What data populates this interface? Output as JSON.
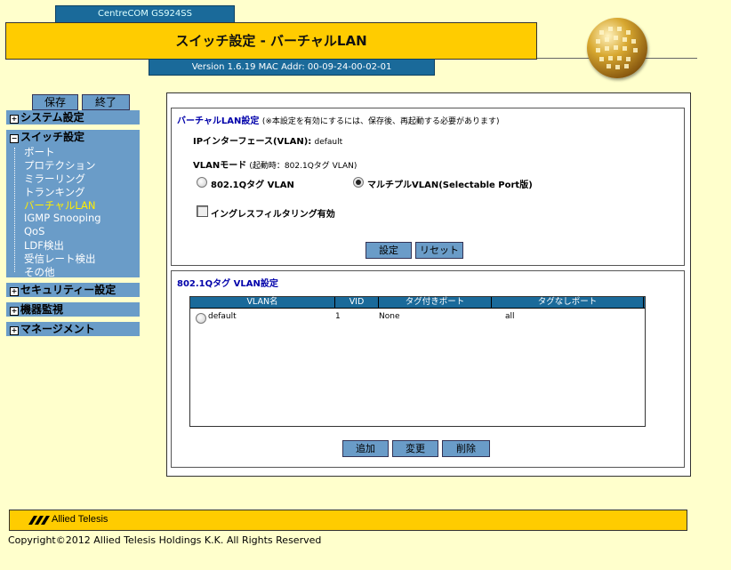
{
  "header": {
    "model": "CentreCOM GS924SS",
    "title": "スイッチ設定 - バーチャルLAN",
    "version": "Version 1.6.19 MAC Addr: 00-09-24-00-02-01"
  },
  "toolbar": {
    "save_label": "保存",
    "exit_label": "終了"
  },
  "sidebar": {
    "system": "システム設定",
    "switch": "スイッチ設定",
    "items": [
      "ポート",
      "プロテクション",
      "ミラーリング",
      "トランキング",
      "バーチャルLAN",
      "IGMP Snooping",
      "QoS",
      "LDF検出",
      "受信レート検出",
      "その他"
    ],
    "active_item": "バーチャルLAN",
    "security": "セキュリティー設定",
    "monitor": "機器監視",
    "management": "マネージメント",
    "expand_glyph": "+",
    "collapse_glyph": "−"
  },
  "vlan_settings": {
    "title": "バーチャルLAN設定",
    "note": "(※本設定を有効にするには、保存後、再起動する必要があります)",
    "ip_interface_label": "IPインターフェース(VLAN):",
    "ip_interface_value": "default",
    "mode_label": "VLANモード",
    "mode_note": "(起動時：802.1Qタグ VLAN)",
    "option_tag": "802.1Qタグ VLAN",
    "option_multiple": "マルチプルVLAN(Selectable Port版)",
    "selected_option": "multiple",
    "ingress_label": "イングレスフィルタリング有効",
    "ingress_checked": false,
    "set_button": "設定",
    "reset_button": "リセット"
  },
  "tag_vlan": {
    "title": "802.1Qタグ VLAN設定",
    "columns": [
      "VLAN名",
      "VID",
      "タグ付きポート",
      "タグなしポート"
    ],
    "rows": [
      {
        "name": "default",
        "vid": "1",
        "tagged": "None",
        "untagged": "all"
      }
    ],
    "add_button": "追加",
    "modify_button": "変更",
    "delete_button": "削除"
  },
  "footer": {
    "brand": "Allied Telesis",
    "copyright": "Copyright©2012 Allied Telesis Holdings K.K. All Rights Reserved"
  },
  "colors": {
    "background": "#ffffcc",
    "title_yellow": "#ffcc00",
    "header_blue": "#1a6a9a",
    "menu_blue": "#6a9cc8",
    "active_menu_text": "#ffee00"
  }
}
